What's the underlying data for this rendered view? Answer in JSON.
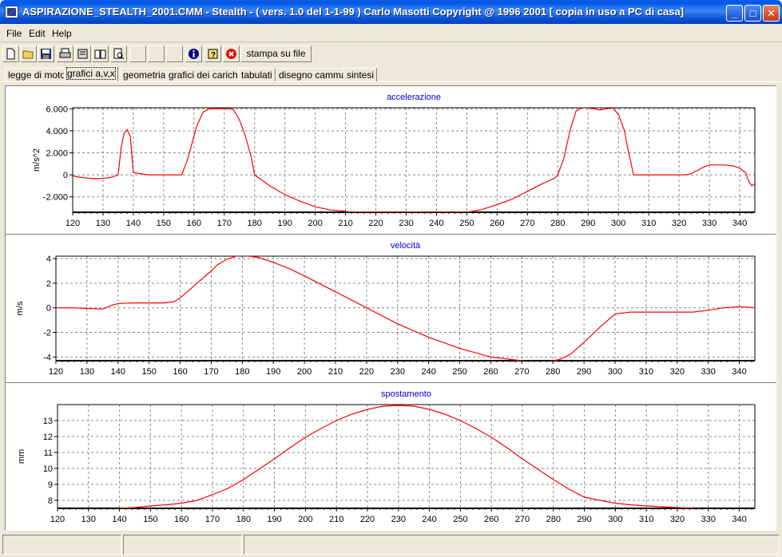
{
  "window": {
    "title": "ASPIRAZIONE_STEALTH_2001.CMM - Stealth -  ( vers. 1.0 del 1-1-99 ) Carlo Masotti Copyright @ 1996 2001  [ copia in uso a PC di casa]",
    "controls": {
      "minimize": "_",
      "maximize": "□",
      "close": "✕"
    }
  },
  "menu": {
    "items": [
      "File",
      "Edit",
      "Help"
    ]
  },
  "toolbar": {
    "icons": [
      "new-file-icon",
      "open-folder-icon",
      "save-icon",
      "print-icon",
      "print-setup-icon",
      "book-icon",
      "print-preview-icon",
      "info-icon",
      "help-icon",
      "stop-icon"
    ],
    "stampa_label": "stampa su file"
  },
  "tabs": {
    "items": [
      "legge di moto",
      "grafici a,v,x",
      "geometria",
      "grafici dei carichi",
      "tabulati",
      "disegno camma",
      "sintesi"
    ],
    "active": "grafici a,v,x"
  },
  "colors": {
    "curve": "#ff0000",
    "title": "#0000cc",
    "grid": "#888888"
  },
  "chart_data": [
    {
      "type": "line",
      "title": "accelerazione",
      "xlabel": "",
      "ylabel": "m/s^2",
      "xlim": [
        120,
        345
      ],
      "ylim": [
        -3400,
        6100
      ],
      "xticks": [
        120,
        130,
        140,
        150,
        160,
        170,
        180,
        190,
        200,
        210,
        220,
        230,
        240,
        250,
        260,
        270,
        280,
        290,
        300,
        310,
        320,
        330,
        340
      ],
      "yticks": [
        6000,
        4000,
        2000,
        0,
        -2000
      ],
      "ytick_labels": [
        "6.000",
        "4.000",
        "2.000",
        "0",
        "-2.000"
      ],
      "grid": true,
      "x": [
        120,
        122,
        125,
        128,
        131,
        133,
        135,
        136,
        137,
        138,
        139,
        140,
        145,
        150,
        155,
        156,
        158,
        160,
        161,
        163,
        165,
        170,
        172,
        173,
        175,
        177,
        179,
        180,
        185,
        190,
        195,
        200,
        205,
        210,
        211,
        250,
        252,
        255,
        260,
        265,
        270,
        275,
        279,
        280,
        282,
        284,
        286,
        288,
        290,
        292,
        294,
        296,
        298,
        300,
        302,
        303,
        305,
        310,
        315,
        320,
        322,
        324,
        326,
        328,
        330,
        335,
        338,
        340,
        342,
        343,
        344,
        345
      ],
      "y": [
        -100,
        -200,
        -300,
        -350,
        -300,
        -200,
        0,
        2500,
        3800,
        4100,
        3500,
        200,
        0,
        0,
        0,
        0,
        1500,
        3500,
        4500,
        5700,
        6000,
        6000,
        6000,
        5950,
        5000,
        3500,
        1500,
        0,
        -1000,
        -1800,
        -2400,
        -2900,
        -3200,
        -3300,
        -3400,
        -3400,
        -3300,
        -3150,
        -2700,
        -2200,
        -1500,
        -800,
        -300,
        0,
        1500,
        4000,
        5800,
        6100,
        6100,
        6000,
        5900,
        6000,
        6100,
        5500,
        4000,
        2500,
        0,
        0,
        0,
        0,
        0,
        100,
        400,
        700,
        900,
        900,
        800,
        600,
        200,
        -600,
        -1000,
        -800
      ]
    },
    {
      "type": "line",
      "title": "velocità",
      "xlabel": "",
      "ylabel": "m/s",
      "xlim": [
        120,
        345
      ],
      "ylim": [
        -4.3,
        4.2
      ],
      "xticks": [
        120,
        130,
        140,
        150,
        160,
        170,
        180,
        190,
        200,
        210,
        220,
        230,
        240,
        250,
        260,
        270,
        280,
        290,
        300,
        310,
        320,
        330,
        340
      ],
      "yticks": [
        4,
        2,
        0,
        -2,
        -4
      ],
      "ytick_labels": [
        "4",
        "2",
        "0",
        "-2",
        "-4"
      ],
      "grid": true,
      "x": [
        120,
        125,
        130,
        135,
        138,
        140,
        145,
        150,
        155,
        158,
        160,
        165,
        170,
        172,
        175,
        178,
        180,
        182,
        185,
        190,
        195,
        200,
        210,
        220,
        230,
        240,
        250,
        260,
        270,
        275,
        278,
        280,
        282,
        284,
        286,
        290,
        295,
        300,
        305,
        310,
        315,
        320,
        325,
        330,
        335,
        340,
        345
      ],
      "y": [
        0,
        0,
        -0.05,
        -0.1,
        0.2,
        0.35,
        0.4,
        0.4,
        0.4,
        0.5,
        0.8,
        1.9,
        3.0,
        3.5,
        3.95,
        4.2,
        4.25,
        4.2,
        4.1,
        3.7,
        3.2,
        2.6,
        1.3,
        0,
        -1.3,
        -2.4,
        -3.3,
        -4.0,
        -4.3,
        -4.4,
        -4.35,
        -4.3,
        -4.2,
        -4.0,
        -3.7,
        -2.8,
        -1.6,
        -0.5,
        -0.35,
        -0.35,
        -0.35,
        -0.35,
        -0.35,
        -0.2,
        0,
        0.1,
        0
      ]
    },
    {
      "type": "line",
      "title": "spostamento",
      "xlabel": "",
      "ylabel": "mm",
      "xlim": [
        120,
        345
      ],
      "ylim": [
        7.5,
        14.0
      ],
      "xticks": [
        120,
        130,
        140,
        150,
        160,
        170,
        180,
        190,
        200,
        210,
        220,
        230,
        240,
        250,
        260,
        270,
        280,
        290,
        300,
        310,
        320,
        330,
        340
      ],
      "yticks": [
        13,
        12,
        11,
        10,
        9,
        8
      ],
      "ytick_labels": [
        "13",
        "12",
        "11",
        "10",
        "9",
        "8"
      ],
      "grid": true,
      "x": [
        140,
        145,
        150,
        155,
        160,
        165,
        170,
        175,
        180,
        185,
        190,
        195,
        200,
        205,
        210,
        215,
        220,
        225,
        230,
        235,
        240,
        245,
        250,
        255,
        260,
        265,
        270,
        275,
        280,
        285,
        290,
        295,
        300,
        305,
        310,
        315,
        320,
        325
      ],
      "y": [
        7.5,
        7.55,
        7.65,
        7.72,
        7.82,
        8.0,
        8.35,
        8.75,
        9.3,
        9.95,
        10.6,
        11.3,
        11.95,
        12.5,
        13.0,
        13.4,
        13.7,
        13.9,
        13.95,
        13.9,
        13.7,
        13.4,
        13.0,
        12.5,
        11.95,
        11.3,
        10.6,
        9.95,
        9.3,
        8.7,
        8.2,
        8.0,
        7.82,
        7.72,
        7.65,
        7.6,
        7.55,
        7.5
      ]
    }
  ]
}
